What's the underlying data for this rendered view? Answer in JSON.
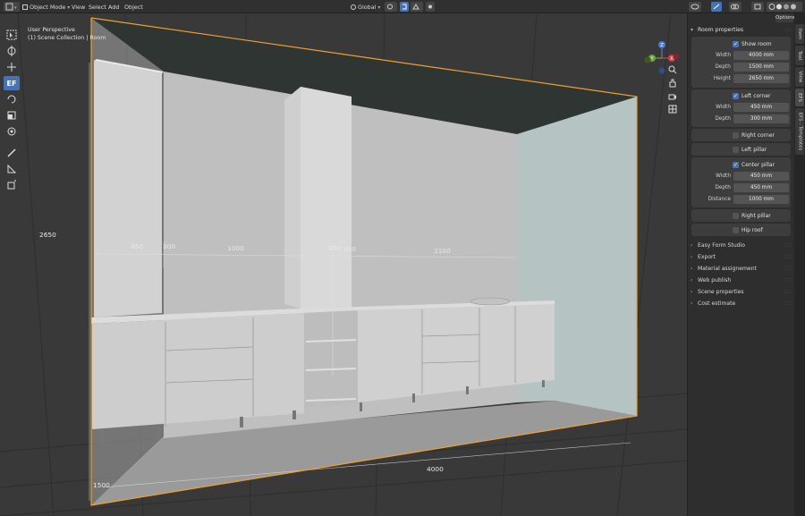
{
  "header": {
    "mode_label": "Object Mode",
    "menus": [
      "View",
      "Select",
      "Add",
      "Object"
    ],
    "transform_orientation": "Global",
    "snap_angle": "000°",
    "object_name": "Room",
    "options_label": "Options"
  },
  "viewport": {
    "perspective_label": "User Perspective",
    "collection_label": "(1) Scene Collection | Room",
    "dimensions": {
      "left_cab": "450",
      "gap": "300",
      "left_run": "1000",
      "pillar_left": "450",
      "pillar_right": "450",
      "right_run": "2100",
      "height": "2650",
      "width": "4000",
      "depth": "1500"
    }
  },
  "gizmo": {
    "z": "Z",
    "y": "Y",
    "x": "X"
  },
  "panel": {
    "room_properties": {
      "title": "Room properties",
      "show_room": {
        "label": "Show room",
        "checked": true
      },
      "width": {
        "label": "Width",
        "value": "4000 mm"
      },
      "depth": {
        "label": "Depth",
        "value": "1500 mm"
      },
      "height": {
        "label": "Height",
        "value": "2650 mm"
      }
    },
    "left_corner": {
      "label": "Left corner",
      "checked": true,
      "width": {
        "label": "Width",
        "value": "450 mm"
      },
      "depth": {
        "label": "Depth",
        "value": "300 mm"
      }
    },
    "right_corner": {
      "label": "Right corner",
      "checked": false
    },
    "left_pillar": {
      "label": "Left pillar",
      "checked": false
    },
    "center_pillar": {
      "label": "Center pillar",
      "checked": true,
      "width": {
        "label": "Width",
        "value": "450 mm"
      },
      "depth": {
        "label": "Depth",
        "value": "450 mm"
      },
      "distance": {
        "label": "Distance",
        "value": "1000 mm"
      }
    },
    "right_pillar": {
      "label": "Right pillar",
      "checked": false
    },
    "hip_roof": {
      "label": "Hip roof",
      "checked": false
    },
    "collapsed_sections": [
      "Easy Form Studio",
      "Export",
      "Material assignement",
      "Web publish",
      "Scene properties",
      "Cost estimate"
    ]
  },
  "side_tabs": [
    "Item",
    "Tool",
    "View",
    "EFS",
    "EFS - Templates"
  ],
  "colors": {
    "accent": "#4772b3",
    "selection_outline": "#f0a030",
    "wall": "#bdbdbd",
    "side_wall": "#b7c6c4"
  }
}
